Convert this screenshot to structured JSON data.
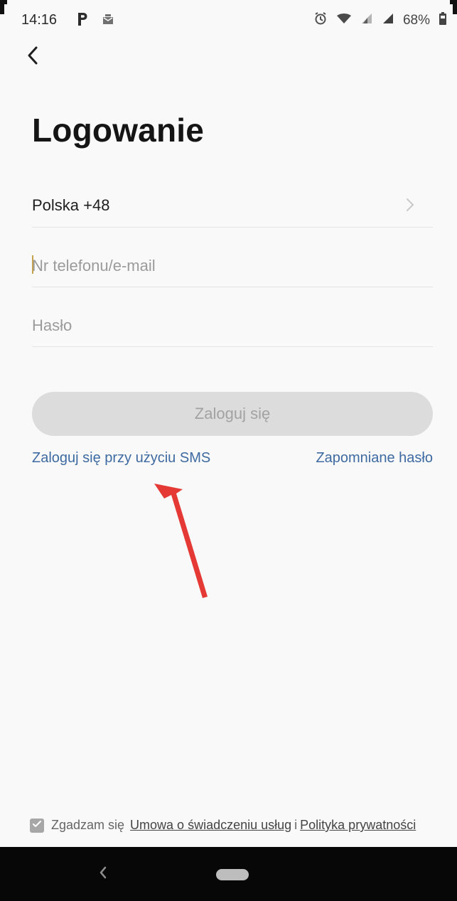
{
  "status_bar": {
    "time": "14:16",
    "left_icons": [
      "p-icon",
      "mail-icon"
    ],
    "right_icons": [
      "alarm-icon",
      "wifi-icon",
      "signal-icon",
      "signal-icon"
    ],
    "battery": "68%"
  },
  "header": {
    "back_icon": "chevron-left-icon"
  },
  "page": {
    "title": "Logowanie",
    "country": {
      "label": "Polska +48",
      "icon": "chevron-right-icon"
    },
    "fields": {
      "phone_email": {
        "value": "",
        "placeholder": "Nr telefonu/e-mail"
      },
      "password": {
        "value": "",
        "placeholder": "Hasło"
      }
    },
    "login_button_label": "Zaloguj się",
    "links": {
      "sms_login": "Zaloguj się przy użyciu SMS",
      "forgot_password": "Zapomniane hasło"
    },
    "annotation_icon": "red-arrow-icon"
  },
  "terms": {
    "checked": true,
    "prefix": "Zgadzam się",
    "service_agreement": "Umowa o świadczeniu usług",
    "conjunction": "i",
    "privacy_policy": "Polityka prywatności"
  },
  "nav_bar": {
    "back_icon": "chevron-left-icon",
    "home_icon": "home-pill-icon"
  },
  "colors": {
    "background": "#f9f9f9",
    "title": "#151515",
    "link": "#3e6aa2",
    "button_disabled": "#dcdcdc",
    "annotation": "#e53935",
    "nav_background": "#070707"
  }
}
